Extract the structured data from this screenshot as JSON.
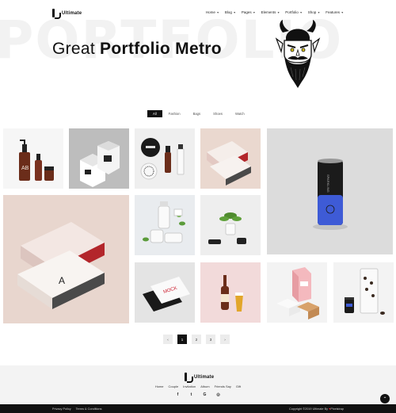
{
  "brand": {
    "name": "Ultimate"
  },
  "nav": [
    {
      "label": "Home"
    },
    {
      "label": "Blog"
    },
    {
      "label": "Pages"
    },
    {
      "label": "Elements"
    },
    {
      "label": "Portfolio"
    },
    {
      "label": "Shop"
    },
    {
      "label": "Features"
    }
  ],
  "hero": {
    "background_text": "PORTFOLIO",
    "title_light": "Great",
    "title_bold": "Portfolio Metro"
  },
  "filters": [
    {
      "label": "All",
      "active": true
    },
    {
      "label": "Fashion",
      "active": false
    },
    {
      "label": "Bags",
      "active": false
    },
    {
      "label": "Shoes",
      "active": false
    },
    {
      "label": "Watch",
      "active": false
    }
  ],
  "pagination": {
    "prev": "‹",
    "pages": [
      "1",
      "2",
      "3"
    ],
    "current": "1",
    "next": "›"
  },
  "footer": {
    "brand": "Ultimate",
    "links": [
      "Home",
      "Couple",
      "Invitation",
      "Album",
      "Friends Say",
      "Gift"
    ],
    "social": [
      "facebook-icon",
      "twitter-icon",
      "google-icon",
      "instagram-icon"
    ],
    "social_glyphs": [
      "f",
      "t",
      "G",
      "◎"
    ],
    "to_top": "⌃"
  },
  "bottombar": {
    "links": [
      "Privacy Policy",
      "Terms & Conditions"
    ],
    "copyright": "Copyright ©2019 Ultimate By",
    "heart": "♥",
    "author": "Pixelstrap"
  },
  "colors": {
    "accent": "#111111",
    "can_blue": "#3e5bd6",
    "box_red": "#b3262b"
  }
}
